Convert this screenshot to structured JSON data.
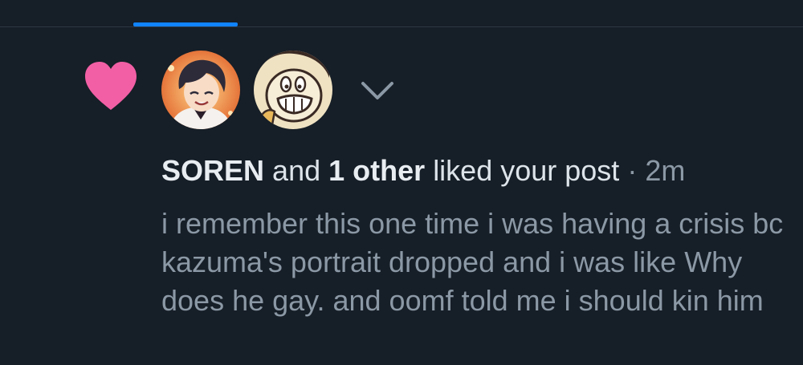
{
  "tabs": {
    "active_index": 0,
    "indicator_color": "#1083fe"
  },
  "notification": {
    "type_icon": "heart-icon",
    "heart_color": "#f25fa5",
    "avatars": [
      {
        "name": "SOREN",
        "icon": "avatar-anime-boy"
      },
      {
        "icon": "avatar-cartoon-face"
      }
    ],
    "expand_icon": "chevron-down-icon",
    "actor_name": "SOREN",
    "connector": "and",
    "other_count": "1 other",
    "action": "liked your post",
    "separator": "·",
    "time": "2m",
    "post_text": "i remember this one time i was having a crisis bc kazuma's portrait dropped and i was like Why does he gay. and oomf told me i should kin him"
  },
  "colors": {
    "background": "#161e27",
    "primary_text": "#dde4ea",
    "secondary_text": "#8b98a5",
    "divider": "#2e3944"
  }
}
